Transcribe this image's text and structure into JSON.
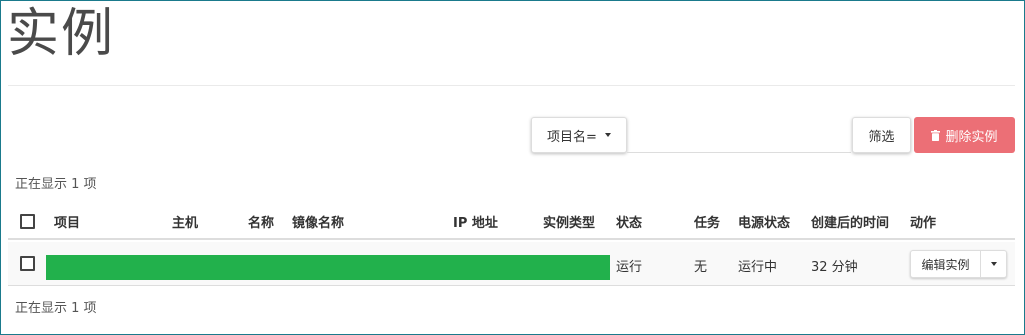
{
  "page": {
    "title": "实例"
  },
  "toolbar": {
    "filter_field_label": "项目名=",
    "filter_value": "",
    "filter_button_label": "筛选",
    "delete_button_label": "删除实例",
    "delete_icon": "trash-icon",
    "delete_color": "#ec6f76"
  },
  "summary": {
    "top": "正在显示 1 项",
    "bottom": "正在显示 1 项"
  },
  "table": {
    "columns": [
      "项目",
      "主机",
      "名称",
      "镜像名称",
      "IP 地址",
      "实例类型",
      "状态",
      "任务",
      "电源状态",
      "创建后的时间",
      "动作"
    ],
    "rows": [
      {
        "redacted_fields": [
          "项目",
          "主机",
          "名称",
          "镜像名称",
          "IP 地址",
          "实例类型"
        ],
        "redaction_color": "#22b14c",
        "status": "运行",
        "task": "无",
        "power_state": "运行中",
        "age": "32 分钟",
        "action_label": "编辑实例"
      }
    ]
  }
}
